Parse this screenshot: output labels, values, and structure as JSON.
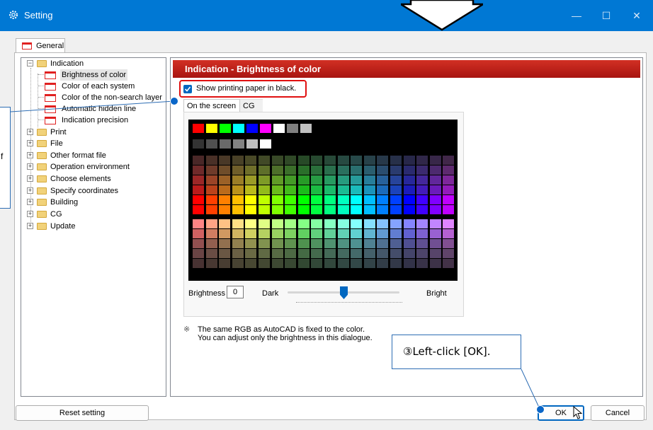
{
  "window": {
    "title": "Setting",
    "tab_general": "General",
    "controls": {
      "minimize": "—",
      "maximize": "☐",
      "close": "✕"
    }
  },
  "tree": {
    "items": [
      {
        "label": "Indication",
        "type": "folder",
        "expanded": true
      },
      {
        "label": "Brightness of color",
        "type": "page",
        "selected": true
      },
      {
        "label": "Color of each system",
        "type": "page"
      },
      {
        "label": "Color of the non-search layer",
        "type": "page"
      },
      {
        "label": "Automatic hidden line",
        "type": "page"
      },
      {
        "label": "Indication precision",
        "type": "page"
      },
      {
        "label": "Print",
        "type": "folder"
      },
      {
        "label": "File",
        "type": "folder"
      },
      {
        "label": "Other format file",
        "type": "folder"
      },
      {
        "label": "Operation environment",
        "type": "folder"
      },
      {
        "label": "Choose elements",
        "type": "folder"
      },
      {
        "label": "Specify coordinates",
        "type": "folder"
      },
      {
        "label": "Building",
        "type": "folder"
      },
      {
        "label": "CG",
        "type": "folder"
      },
      {
        "label": "Update",
        "type": "folder"
      }
    ]
  },
  "panel": {
    "header": "Indication - Brightness of color",
    "checkbox_label": "Show printing paper in black.",
    "checkbox_checked": true,
    "tabs": [
      "On the screen",
      "CG"
    ],
    "brightness_label": "Brightness",
    "brightness_value": "0",
    "dark_label": "Dark",
    "bright_label": "Bright",
    "slider_level": 0.5,
    "note_mark": "※",
    "note_line1": "The same RGB as AutoCAD is fixed to the color.",
    "note_line2": "You can adjust only the brightness in this dialogue."
  },
  "buttons": {
    "reset": "Reset setting",
    "ok": "OK",
    "cancel": "Cancel"
  },
  "callouts": {
    "ok": "③Left-click [OK].",
    "left_partial": "f"
  },
  "colors": {
    "titlebar": "#0078d4",
    "header_red": "#c42418",
    "highlight_red": "#e01010",
    "accent_blue": "#0067c0"
  }
}
